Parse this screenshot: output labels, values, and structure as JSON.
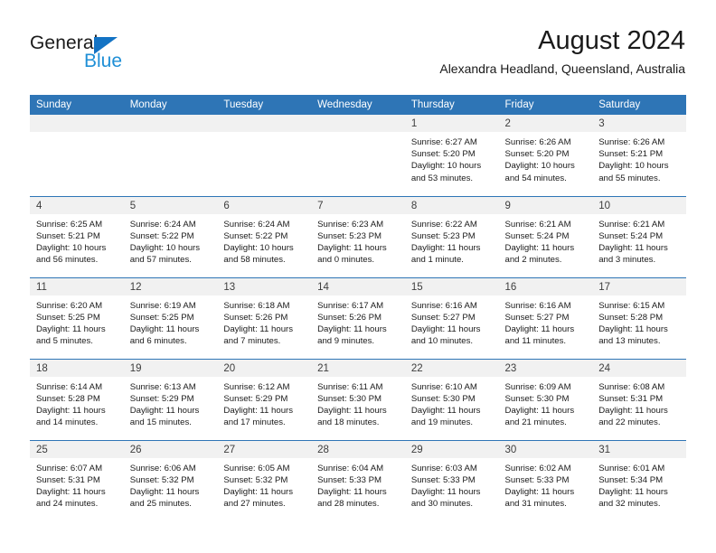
{
  "brand": {
    "name_part1": "General",
    "name_part2": "Blue"
  },
  "header": {
    "month_title": "August 2024",
    "location": "Alexandra Headland, Queensland, Australia"
  },
  "colors": {
    "header_blue": "#2e75b6",
    "logo_blue": "#1f8fd6",
    "daynum_band": "#f1f1f1"
  },
  "weekday_headers": [
    "Sunday",
    "Monday",
    "Tuesday",
    "Wednesday",
    "Thursday",
    "Friday",
    "Saturday"
  ],
  "chart_data": {
    "type": "table",
    "title": "August 2024",
    "subtitle": "Alexandra Headland, Queensland, Australia",
    "columns": [
      "Sunday",
      "Monday",
      "Tuesday",
      "Wednesday",
      "Thursday",
      "Friday",
      "Saturday"
    ]
  },
  "weeks": [
    [
      {
        "day": "",
        "empty": true,
        "sunrise": "",
        "sunset": "",
        "daylight1": "",
        "daylight2": ""
      },
      {
        "day": "",
        "empty": true,
        "sunrise": "",
        "sunset": "",
        "daylight1": "",
        "daylight2": ""
      },
      {
        "day": "",
        "empty": true,
        "sunrise": "",
        "sunset": "",
        "daylight1": "",
        "daylight2": ""
      },
      {
        "day": "",
        "empty": true,
        "sunrise": "",
        "sunset": "",
        "daylight1": "",
        "daylight2": ""
      },
      {
        "day": "1",
        "empty": false,
        "sunrise": "Sunrise: 6:27 AM",
        "sunset": "Sunset: 5:20 PM",
        "daylight1": "Daylight: 10 hours",
        "daylight2": "and 53 minutes."
      },
      {
        "day": "2",
        "empty": false,
        "sunrise": "Sunrise: 6:26 AM",
        "sunset": "Sunset: 5:20 PM",
        "daylight1": "Daylight: 10 hours",
        "daylight2": "and 54 minutes."
      },
      {
        "day": "3",
        "empty": false,
        "sunrise": "Sunrise: 6:26 AM",
        "sunset": "Sunset: 5:21 PM",
        "daylight1": "Daylight: 10 hours",
        "daylight2": "and 55 minutes."
      }
    ],
    [
      {
        "day": "4",
        "empty": false,
        "sunrise": "Sunrise: 6:25 AM",
        "sunset": "Sunset: 5:21 PM",
        "daylight1": "Daylight: 10 hours",
        "daylight2": "and 56 minutes."
      },
      {
        "day": "5",
        "empty": false,
        "sunrise": "Sunrise: 6:24 AM",
        "sunset": "Sunset: 5:22 PM",
        "daylight1": "Daylight: 10 hours",
        "daylight2": "and 57 minutes."
      },
      {
        "day": "6",
        "empty": false,
        "sunrise": "Sunrise: 6:24 AM",
        "sunset": "Sunset: 5:22 PM",
        "daylight1": "Daylight: 10 hours",
        "daylight2": "and 58 minutes."
      },
      {
        "day": "7",
        "empty": false,
        "sunrise": "Sunrise: 6:23 AM",
        "sunset": "Sunset: 5:23 PM",
        "daylight1": "Daylight: 11 hours",
        "daylight2": "and 0 minutes."
      },
      {
        "day": "8",
        "empty": false,
        "sunrise": "Sunrise: 6:22 AM",
        "sunset": "Sunset: 5:23 PM",
        "daylight1": "Daylight: 11 hours",
        "daylight2": "and 1 minute."
      },
      {
        "day": "9",
        "empty": false,
        "sunrise": "Sunrise: 6:21 AM",
        "sunset": "Sunset: 5:24 PM",
        "daylight1": "Daylight: 11 hours",
        "daylight2": "and 2 minutes."
      },
      {
        "day": "10",
        "empty": false,
        "sunrise": "Sunrise: 6:21 AM",
        "sunset": "Sunset: 5:24 PM",
        "daylight1": "Daylight: 11 hours",
        "daylight2": "and 3 minutes."
      }
    ],
    [
      {
        "day": "11",
        "empty": false,
        "sunrise": "Sunrise: 6:20 AM",
        "sunset": "Sunset: 5:25 PM",
        "daylight1": "Daylight: 11 hours",
        "daylight2": "and 5 minutes."
      },
      {
        "day": "12",
        "empty": false,
        "sunrise": "Sunrise: 6:19 AM",
        "sunset": "Sunset: 5:25 PM",
        "daylight1": "Daylight: 11 hours",
        "daylight2": "and 6 minutes."
      },
      {
        "day": "13",
        "empty": false,
        "sunrise": "Sunrise: 6:18 AM",
        "sunset": "Sunset: 5:26 PM",
        "daylight1": "Daylight: 11 hours",
        "daylight2": "and 7 minutes."
      },
      {
        "day": "14",
        "empty": false,
        "sunrise": "Sunrise: 6:17 AM",
        "sunset": "Sunset: 5:26 PM",
        "daylight1": "Daylight: 11 hours",
        "daylight2": "and 9 minutes."
      },
      {
        "day": "15",
        "empty": false,
        "sunrise": "Sunrise: 6:16 AM",
        "sunset": "Sunset: 5:27 PM",
        "daylight1": "Daylight: 11 hours",
        "daylight2": "and 10 minutes."
      },
      {
        "day": "16",
        "empty": false,
        "sunrise": "Sunrise: 6:16 AM",
        "sunset": "Sunset: 5:27 PM",
        "daylight1": "Daylight: 11 hours",
        "daylight2": "and 11 minutes."
      },
      {
        "day": "17",
        "empty": false,
        "sunrise": "Sunrise: 6:15 AM",
        "sunset": "Sunset: 5:28 PM",
        "daylight1": "Daylight: 11 hours",
        "daylight2": "and 13 minutes."
      }
    ],
    [
      {
        "day": "18",
        "empty": false,
        "sunrise": "Sunrise: 6:14 AM",
        "sunset": "Sunset: 5:28 PM",
        "daylight1": "Daylight: 11 hours",
        "daylight2": "and 14 minutes."
      },
      {
        "day": "19",
        "empty": false,
        "sunrise": "Sunrise: 6:13 AM",
        "sunset": "Sunset: 5:29 PM",
        "daylight1": "Daylight: 11 hours",
        "daylight2": "and 15 minutes."
      },
      {
        "day": "20",
        "empty": false,
        "sunrise": "Sunrise: 6:12 AM",
        "sunset": "Sunset: 5:29 PM",
        "daylight1": "Daylight: 11 hours",
        "daylight2": "and 17 minutes."
      },
      {
        "day": "21",
        "empty": false,
        "sunrise": "Sunrise: 6:11 AM",
        "sunset": "Sunset: 5:30 PM",
        "daylight1": "Daylight: 11 hours",
        "daylight2": "and 18 minutes."
      },
      {
        "day": "22",
        "empty": false,
        "sunrise": "Sunrise: 6:10 AM",
        "sunset": "Sunset: 5:30 PM",
        "daylight1": "Daylight: 11 hours",
        "daylight2": "and 19 minutes."
      },
      {
        "day": "23",
        "empty": false,
        "sunrise": "Sunrise: 6:09 AM",
        "sunset": "Sunset: 5:30 PM",
        "daylight1": "Daylight: 11 hours",
        "daylight2": "and 21 minutes."
      },
      {
        "day": "24",
        "empty": false,
        "sunrise": "Sunrise: 6:08 AM",
        "sunset": "Sunset: 5:31 PM",
        "daylight1": "Daylight: 11 hours",
        "daylight2": "and 22 minutes."
      }
    ],
    [
      {
        "day": "25",
        "empty": false,
        "sunrise": "Sunrise: 6:07 AM",
        "sunset": "Sunset: 5:31 PM",
        "daylight1": "Daylight: 11 hours",
        "daylight2": "and 24 minutes."
      },
      {
        "day": "26",
        "empty": false,
        "sunrise": "Sunrise: 6:06 AM",
        "sunset": "Sunset: 5:32 PM",
        "daylight1": "Daylight: 11 hours",
        "daylight2": "and 25 minutes."
      },
      {
        "day": "27",
        "empty": false,
        "sunrise": "Sunrise: 6:05 AM",
        "sunset": "Sunset: 5:32 PM",
        "daylight1": "Daylight: 11 hours",
        "daylight2": "and 27 minutes."
      },
      {
        "day": "28",
        "empty": false,
        "sunrise": "Sunrise: 6:04 AM",
        "sunset": "Sunset: 5:33 PM",
        "daylight1": "Daylight: 11 hours",
        "daylight2": "and 28 minutes."
      },
      {
        "day": "29",
        "empty": false,
        "sunrise": "Sunrise: 6:03 AM",
        "sunset": "Sunset: 5:33 PM",
        "daylight1": "Daylight: 11 hours",
        "daylight2": "and 30 minutes."
      },
      {
        "day": "30",
        "empty": false,
        "sunrise": "Sunrise: 6:02 AM",
        "sunset": "Sunset: 5:33 PM",
        "daylight1": "Daylight: 11 hours",
        "daylight2": "and 31 minutes."
      },
      {
        "day": "31",
        "empty": false,
        "sunrise": "Sunrise: 6:01 AM",
        "sunset": "Sunset: 5:34 PM",
        "daylight1": "Daylight: 11 hours",
        "daylight2": "and 32 minutes."
      }
    ]
  ]
}
